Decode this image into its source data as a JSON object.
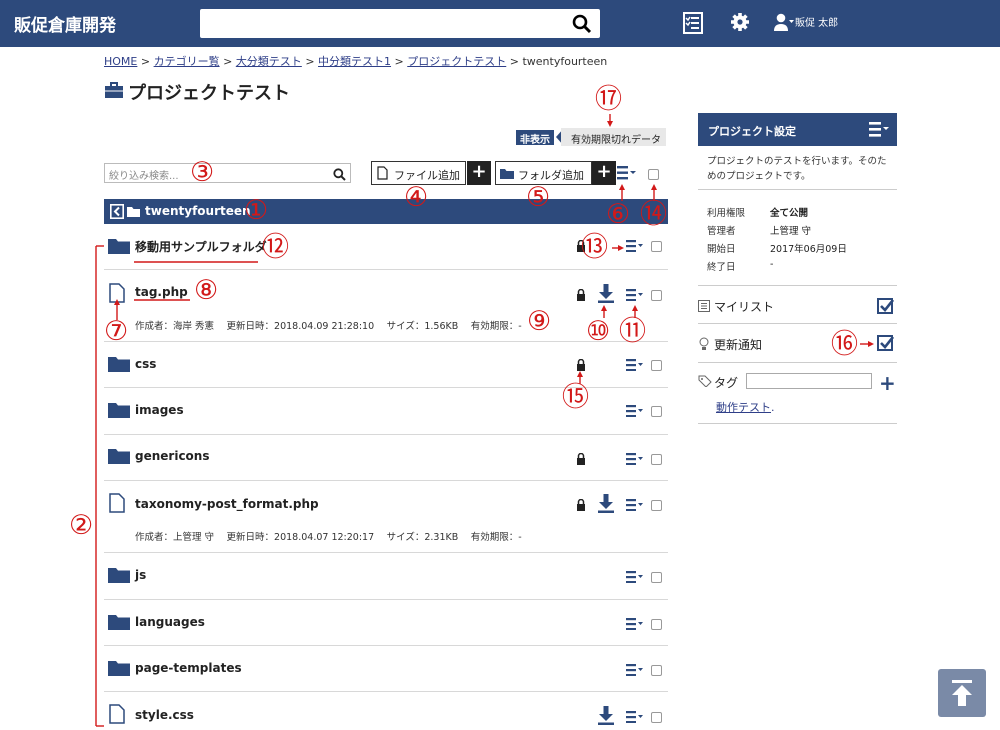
{
  "app": {
    "title": "販促倉庫開発",
    "user": "販促 太郎"
  },
  "breadcrumb": {
    "items": [
      "HOME",
      "カテゴリー覧",
      "大分類テスト",
      "中分類テスト1",
      "プロジェクトテスト"
    ],
    "current": "twentyfourteen",
    "separator": ">"
  },
  "page": {
    "title": "プロジェクトテスト"
  },
  "expired": {
    "tag": "非表示",
    "label": "有効期限切れデータ"
  },
  "toolbar": {
    "filter_placeholder": "絞り込み検索...",
    "add_file": "ファイル追加",
    "add_folder": "フォルダ追加"
  },
  "folder_bar": {
    "name": "twentyfourteen"
  },
  "rows": [
    {
      "type": "folder",
      "name": "移動用サンプルフォルダ",
      "lock": true,
      "download": false
    },
    {
      "type": "file",
      "name": "tag.php",
      "lock": true,
      "download": true,
      "meta": "作成者：海岸 秀憲　 更新日時：2018.04.09 21:28:10　 サイズ：1.56KB　 有効期限：-"
    },
    {
      "type": "folder",
      "name": "css",
      "lock": true,
      "download": false
    },
    {
      "type": "folder",
      "name": "images",
      "lock": false,
      "download": false
    },
    {
      "type": "folder",
      "name": "genericons",
      "lock": true,
      "download": false
    },
    {
      "type": "file",
      "name": "taxonomy-post_format.php",
      "lock": true,
      "download": true,
      "meta": "作成者：上管理 守　 更新日時：2018.04.07 12:20:17　 サイズ：2.31KB　 有効期限：-"
    },
    {
      "type": "folder",
      "name": "js",
      "lock": false,
      "download": false
    },
    {
      "type": "folder",
      "name": "languages",
      "lock": false,
      "download": false
    },
    {
      "type": "folder",
      "name": "page-templates",
      "lock": false,
      "download": false
    },
    {
      "type": "file",
      "name": "style.css",
      "lock": false,
      "download": true
    }
  ],
  "sidebar": {
    "header": "プロジェクト設定",
    "description": "プロジェクトのテストを行います。そのためのプロジェクトです。",
    "info": [
      {
        "key": "利用権限",
        "value": "全て公開"
      },
      {
        "key": "管理者",
        "value": "上管理 守"
      },
      {
        "key": "開始日",
        "value": "2017年06月09日"
      },
      {
        "key": "終了日",
        "value": "-"
      }
    ],
    "mylist": "マイリスト",
    "notify": "更新通知",
    "tag_label": "タグ",
    "tag_link": "動作テスト",
    "tag_suffix": "."
  },
  "annotations": [
    "①",
    "②",
    "③",
    "④",
    "⑤",
    "⑥",
    "⑦",
    "⑧",
    "⑨",
    "⑩",
    "⑪",
    "⑫",
    "⑬",
    "⑭",
    "⑮",
    "⑯",
    "⑰"
  ],
  "colors": {
    "brand": "#2d4a7c",
    "annotation": "#d21919"
  }
}
